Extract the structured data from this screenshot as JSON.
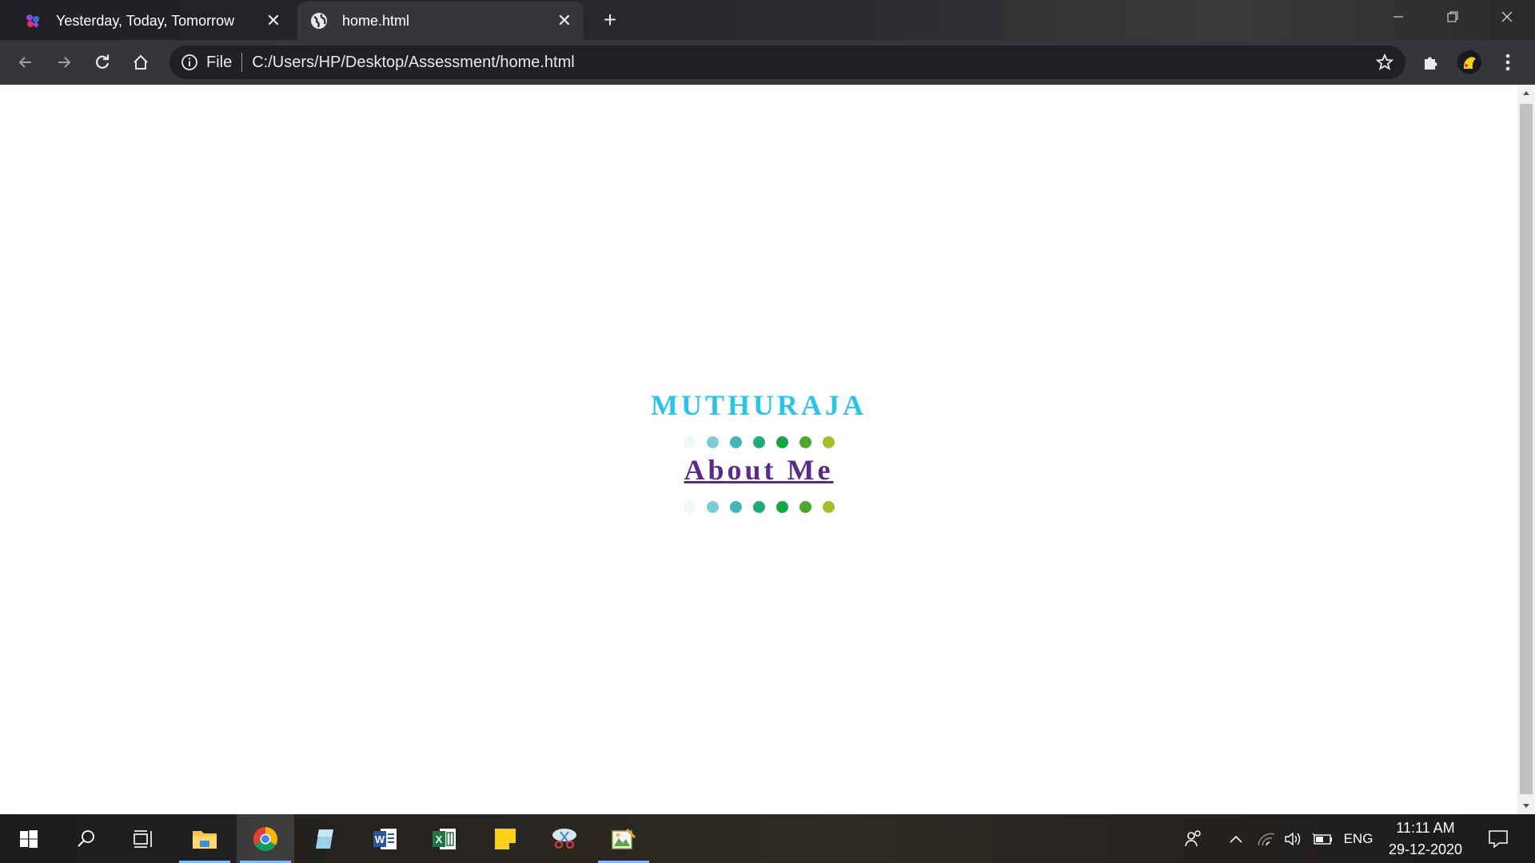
{
  "browser": {
    "tabs": [
      {
        "label": "Yesterday, Today, Tomorrow",
        "favicon": "flower-icon",
        "active": false
      },
      {
        "label": "home.html",
        "favicon": "globe-icon",
        "active": true
      }
    ],
    "address": {
      "scheme_label": "File",
      "url": "C:/Users/HP/Desktop/Assessment/home.html"
    }
  },
  "page": {
    "name": "MUTHURAJA",
    "link_label": "About Me",
    "dot_colors": [
      "#eef7fb",
      "#7ec8d8",
      "#3fb6b7",
      "#1faa7f",
      "#16a34a",
      "#4aa82a",
      "#a3bf2b"
    ],
    "name_color": "#29c3ec",
    "link_color": "#5b2a8a"
  },
  "taskbar": {
    "language": "ENG",
    "time": "11:11 AM",
    "date": "29-12-2020"
  }
}
